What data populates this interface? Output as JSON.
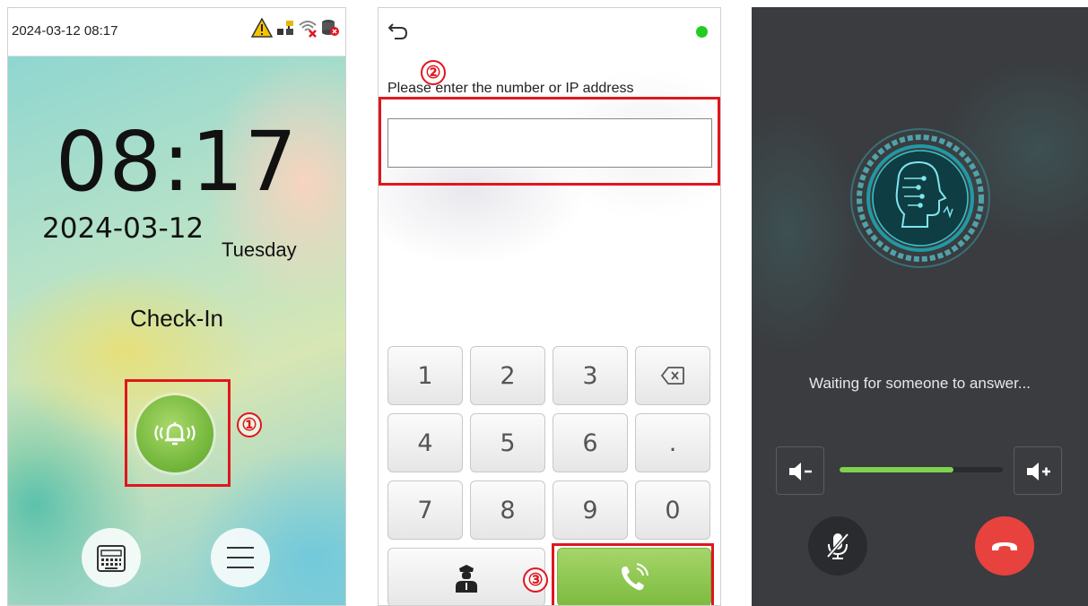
{
  "panel1": {
    "status_time": "2024-03-12 08:17",
    "status_icons": [
      "warning-icon",
      "network-icon",
      "wifi-off-icon",
      "database-icon"
    ],
    "clock": "08:17",
    "date": "2024-03-12",
    "weekday": "Tuesday",
    "mode": "Check-In",
    "bell_icon": "doorbell-icon",
    "marker": "①",
    "bottom_icons": [
      "keyboard-icon",
      "menu-icon"
    ]
  },
  "panel2": {
    "marker_input": "②",
    "marker_call": "③",
    "prompt": "Please enter the number or IP address",
    "input_value": "",
    "keys": [
      "1",
      "2",
      "3",
      "⌫",
      "4",
      "5",
      "6",
      ".",
      "7",
      "8",
      "9",
      "0"
    ],
    "status_dot_color": "#22cc22"
  },
  "panel3": {
    "waiting_text": "Waiting for someone to answer...",
    "volume_fraction": 0.7,
    "accent_color": "#7fd24e",
    "hangup_color": "#e8423f"
  }
}
